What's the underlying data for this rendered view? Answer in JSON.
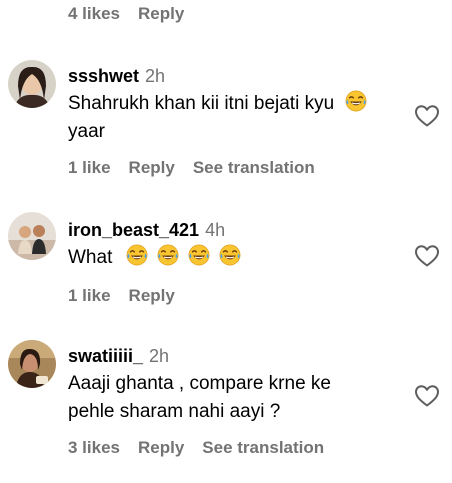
{
  "top": {
    "likes": "4 likes",
    "reply": "Reply"
  },
  "comments": [
    {
      "username": "ssshwet",
      "time": "2h",
      "text_line1": "Shahrukh khan kii itni bejati kyu",
      "text_line2": "yaar",
      "likes": "1 like",
      "reply": "Reply",
      "translate": "See translation"
    },
    {
      "username": "iron_beast_421",
      "time": "4h",
      "text": "What",
      "likes": "1 like",
      "reply": "Reply"
    },
    {
      "username": "swatiiiii_",
      "time": "2h",
      "text_line1": "Aaaji ghanta , compare krne ke",
      "text_line2": "pehle sharam nahi aayi ?",
      "likes": "3 likes",
      "reply": "Reply",
      "translate": "See translation"
    }
  ],
  "icons": {
    "heart": "heart-outline-icon",
    "emoji": "face-with-tears-of-joy-icon"
  },
  "colors": {
    "secondary_text": "#737373",
    "primary_text": "#000000",
    "background": "#ffffff"
  }
}
